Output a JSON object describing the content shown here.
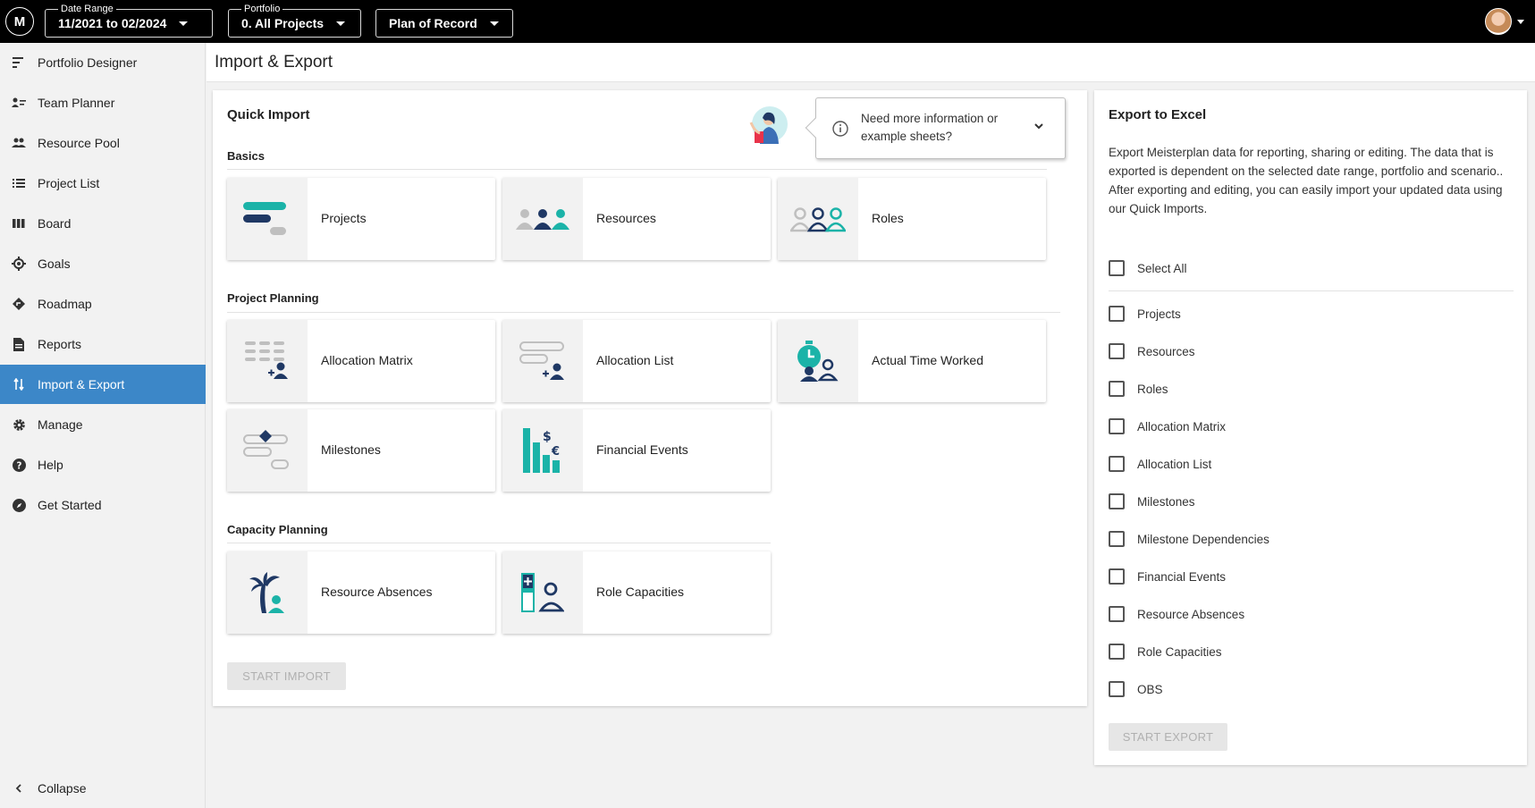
{
  "topbar": {
    "logo": "M",
    "date_range": {
      "label": "Date Range",
      "value": "11/2021 to 02/2024"
    },
    "portfolio": {
      "label": "Portfolio",
      "value": "0. All Projects"
    },
    "scenario": {
      "value": "Plan of Record"
    }
  },
  "sidebar": {
    "items": [
      {
        "label": "Portfolio Designer",
        "icon": "portfolio-designer-icon"
      },
      {
        "label": "Team Planner",
        "icon": "team-planner-icon"
      },
      {
        "label": "Resource Pool",
        "icon": "resource-pool-icon"
      },
      {
        "label": "Project List",
        "icon": "project-list-icon"
      },
      {
        "label": "Board",
        "icon": "board-icon"
      },
      {
        "label": "Goals",
        "icon": "goals-icon"
      },
      {
        "label": "Roadmap",
        "icon": "roadmap-icon"
      },
      {
        "label": "Reports",
        "icon": "reports-icon"
      },
      {
        "label": "Import & Export",
        "icon": "import-export-icon",
        "active": true
      },
      {
        "label": "Manage",
        "icon": "gear-icon"
      },
      {
        "label": "Help",
        "icon": "help-icon"
      },
      {
        "label": "Get Started",
        "icon": "compass-icon"
      }
    ],
    "collapse": "Collapse"
  },
  "page": {
    "title": "Import & Export"
  },
  "quick_import": {
    "title": "Quick Import",
    "info": "Need more information or example sheets?",
    "sections": {
      "basics": "Basics",
      "project_planning": "Project Planning",
      "capacity_planning": "Capacity Planning"
    },
    "cards": {
      "projects": "Projects",
      "resources": "Resources",
      "roles": "Roles",
      "allocation_matrix": "Allocation Matrix",
      "allocation_list": "Allocation List",
      "actual_time_worked": "Actual Time Worked",
      "milestones": "Milestones",
      "financial_events": "Financial Events",
      "resource_absences": "Resource Absences",
      "role_capacities": "Role Capacities"
    },
    "start_button": "START IMPORT"
  },
  "export": {
    "title": "Export to Excel",
    "description_1": "Export Meisterplan data for reporting, sharing or editing. The data that is exported is dependent on the selected date range, portfolio and scenario..",
    "description_2": "After exporting and editing, you can easily import your updated data using our Quick Imports.",
    "select_all": "Select All",
    "options": [
      "Projects",
      "Resources",
      "Roles",
      "Allocation Matrix",
      "Allocation List",
      "Milestones",
      "Milestone Dependencies",
      "Financial Events",
      "Resource Absences",
      "Role Capacities",
      "OBS"
    ],
    "start_button": "START EXPORT"
  },
  "colors": {
    "accent_blue": "#3c87c8",
    "teal": "#1bb3a8",
    "navy": "#1f3864",
    "topbar": "#000000"
  }
}
